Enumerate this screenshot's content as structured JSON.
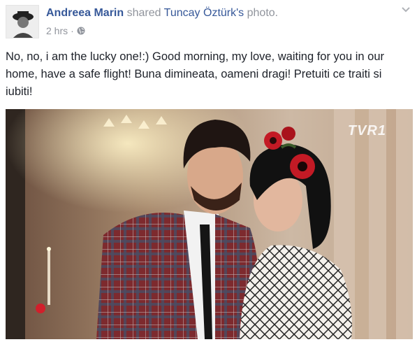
{
  "post": {
    "author": "Andreea Marin",
    "shared_word": "shared",
    "target": "Tuncay Öztürk's",
    "object": "photo.",
    "timestamp": "2 hrs",
    "separator": "·",
    "privacy_icon": "globe-icon",
    "message": "No, no, i am the lucky one!:) Good morning, my love, waiting for you in our home, have a safe flight! Buna dimineata, oameni dragi! Pretuiti ce traiti si iubiti!",
    "photo": {
      "watermark": "TVR1"
    }
  },
  "colors": {
    "link": "#365899",
    "meta": "#90949c",
    "text": "#1d2129"
  }
}
